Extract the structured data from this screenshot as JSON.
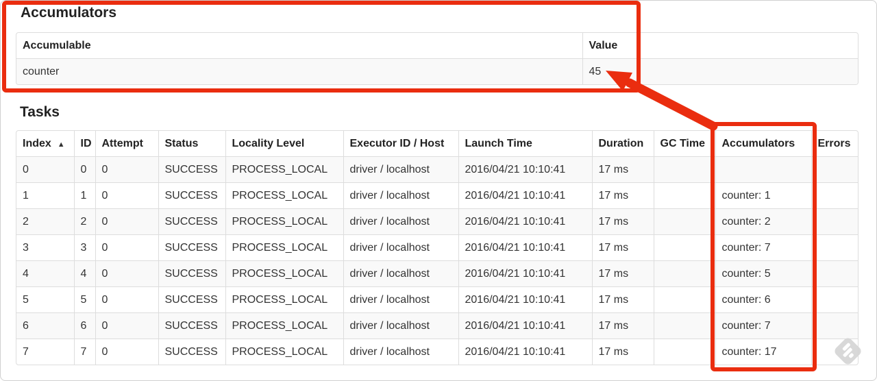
{
  "accumulators_section": {
    "title": "Accumulators",
    "table": {
      "headers": [
        {
          "label": "Accumulable"
        },
        {
          "label": "Value"
        }
      ],
      "rows": [
        [
          "counter",
          "45"
        ]
      ]
    }
  },
  "tasks_section": {
    "title": "Tasks",
    "table": {
      "sort_icon": "▲",
      "headers": [
        {
          "label": "Index",
          "sorted": true
        },
        {
          "label": "ID"
        },
        {
          "label": "Attempt"
        },
        {
          "label": "Status"
        },
        {
          "label": "Locality Level"
        },
        {
          "label": "Executor ID / Host"
        },
        {
          "label": "Launch Time"
        },
        {
          "label": "Duration"
        },
        {
          "label": "GC Time"
        },
        {
          "label": "Accumulators"
        },
        {
          "label": "Errors"
        }
      ],
      "rows": [
        [
          "0",
          "0",
          "0",
          "SUCCESS",
          "PROCESS_LOCAL",
          "driver / localhost",
          "2016/04/21 10:10:41",
          "17 ms",
          "",
          "",
          ""
        ],
        [
          "1",
          "1",
          "0",
          "SUCCESS",
          "PROCESS_LOCAL",
          "driver / localhost",
          "2016/04/21 10:10:41",
          "17 ms",
          "",
          "counter: 1",
          ""
        ],
        [
          "2",
          "2",
          "0",
          "SUCCESS",
          "PROCESS_LOCAL",
          "driver / localhost",
          "2016/04/21 10:10:41",
          "17 ms",
          "",
          "counter: 2",
          ""
        ],
        [
          "3",
          "3",
          "0",
          "SUCCESS",
          "PROCESS_LOCAL",
          "driver / localhost",
          "2016/04/21 10:10:41",
          "17 ms",
          "",
          "counter: 7",
          ""
        ],
        [
          "4",
          "4",
          "0",
          "SUCCESS",
          "PROCESS_LOCAL",
          "driver / localhost",
          "2016/04/21 10:10:41",
          "17 ms",
          "",
          "counter: 5",
          ""
        ],
        [
          "5",
          "5",
          "0",
          "SUCCESS",
          "PROCESS_LOCAL",
          "driver / localhost",
          "2016/04/21 10:10:41",
          "17 ms",
          "",
          "counter: 6",
          ""
        ],
        [
          "6",
          "6",
          "0",
          "SUCCESS",
          "PROCESS_LOCAL",
          "driver / localhost",
          "2016/04/21 10:10:41",
          "17 ms",
          "",
          "counter: 7",
          ""
        ],
        [
          "7",
          "7",
          "0",
          "SUCCESS",
          "PROCESS_LOCAL",
          "driver / localhost",
          "2016/04/21 10:10:41",
          "17 ms",
          "",
          "counter: 17",
          ""
        ]
      ]
    }
  },
  "annotations": {
    "color": "#ea2d0f",
    "highlight_1": "accumulators-summary-box",
    "highlight_2": "accumulators-column-box",
    "arrow_target_value": "45"
  }
}
